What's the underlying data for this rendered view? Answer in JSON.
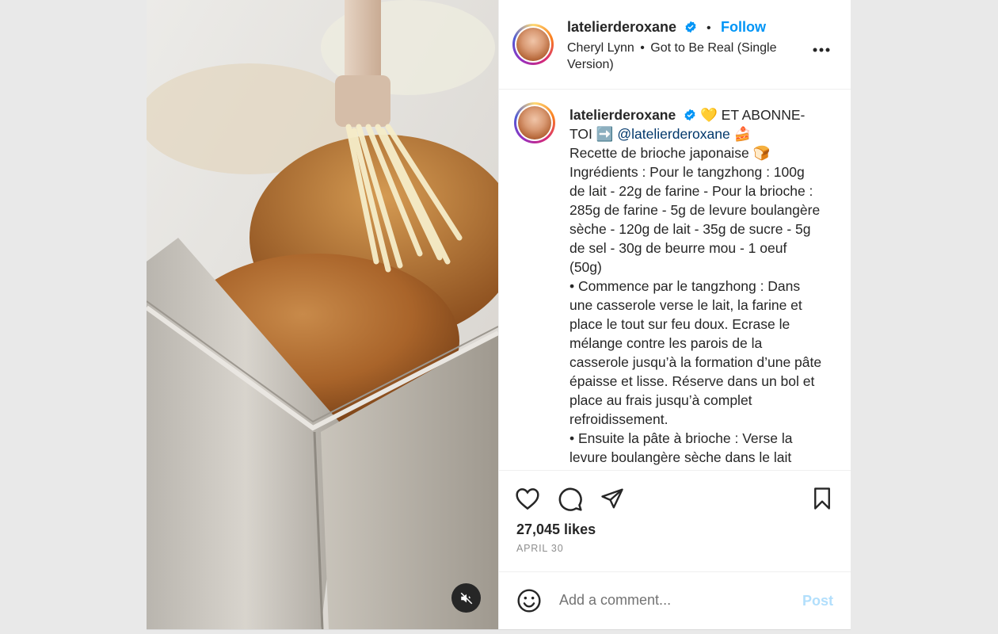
{
  "post": {
    "author": {
      "username": "latelierderoxane",
      "verified": true,
      "follow_label": "Follow",
      "separator": "•"
    },
    "music": {
      "artist": "Cheryl Lynn",
      "separator": "•",
      "title": "Got to Be Real (Single Version)"
    },
    "more_icon": "more-horizontal-icon",
    "caption": {
      "username": "latelierderoxane",
      "heart_emoji": "💛",
      "intro": "ET ABONNE-TOI",
      "arrow_emoji": "➡️",
      "mention": "@latelierderoxane",
      "cake_emoji": "🍰",
      "lines": [
        "Recette de brioche japonaise 🍞",
        "Ingrédients : Pour le tangzhong : 100g de lait - 22g de farine - Pour la brioche : 285g de farine - 5g de levure boulangère sèche - 120g de lait - 35g de sucre - 5g de sel - 30g de beurre mou - 1 oeuf (50g)",
        "• Commence par le tangzhong : Dans une casserole verse le lait, la farine et place le tout sur feu doux. Ecrase le mélange contre les parois de la casserole jusqu’à la formation d’une pâte épaisse et lisse. Réserve dans un bol et place au frais jusqu’à complet refroidissement.",
        "• Ensuite la pâte à brioche : Verse la levure boulangère sèche dans le lait"
      ]
    },
    "actions": {
      "like_icon": "heart-icon",
      "comment_icon": "comment-icon",
      "share_icon": "send-icon",
      "save_icon": "bookmark-icon"
    },
    "likes": "27,045 likes",
    "date": "APRIL 30",
    "comment": {
      "emoji_icon": "smiley-icon",
      "placeholder": "Add a comment...",
      "post_label": "Post"
    },
    "media": {
      "mute_icon": "muted-speaker-icon"
    }
  }
}
